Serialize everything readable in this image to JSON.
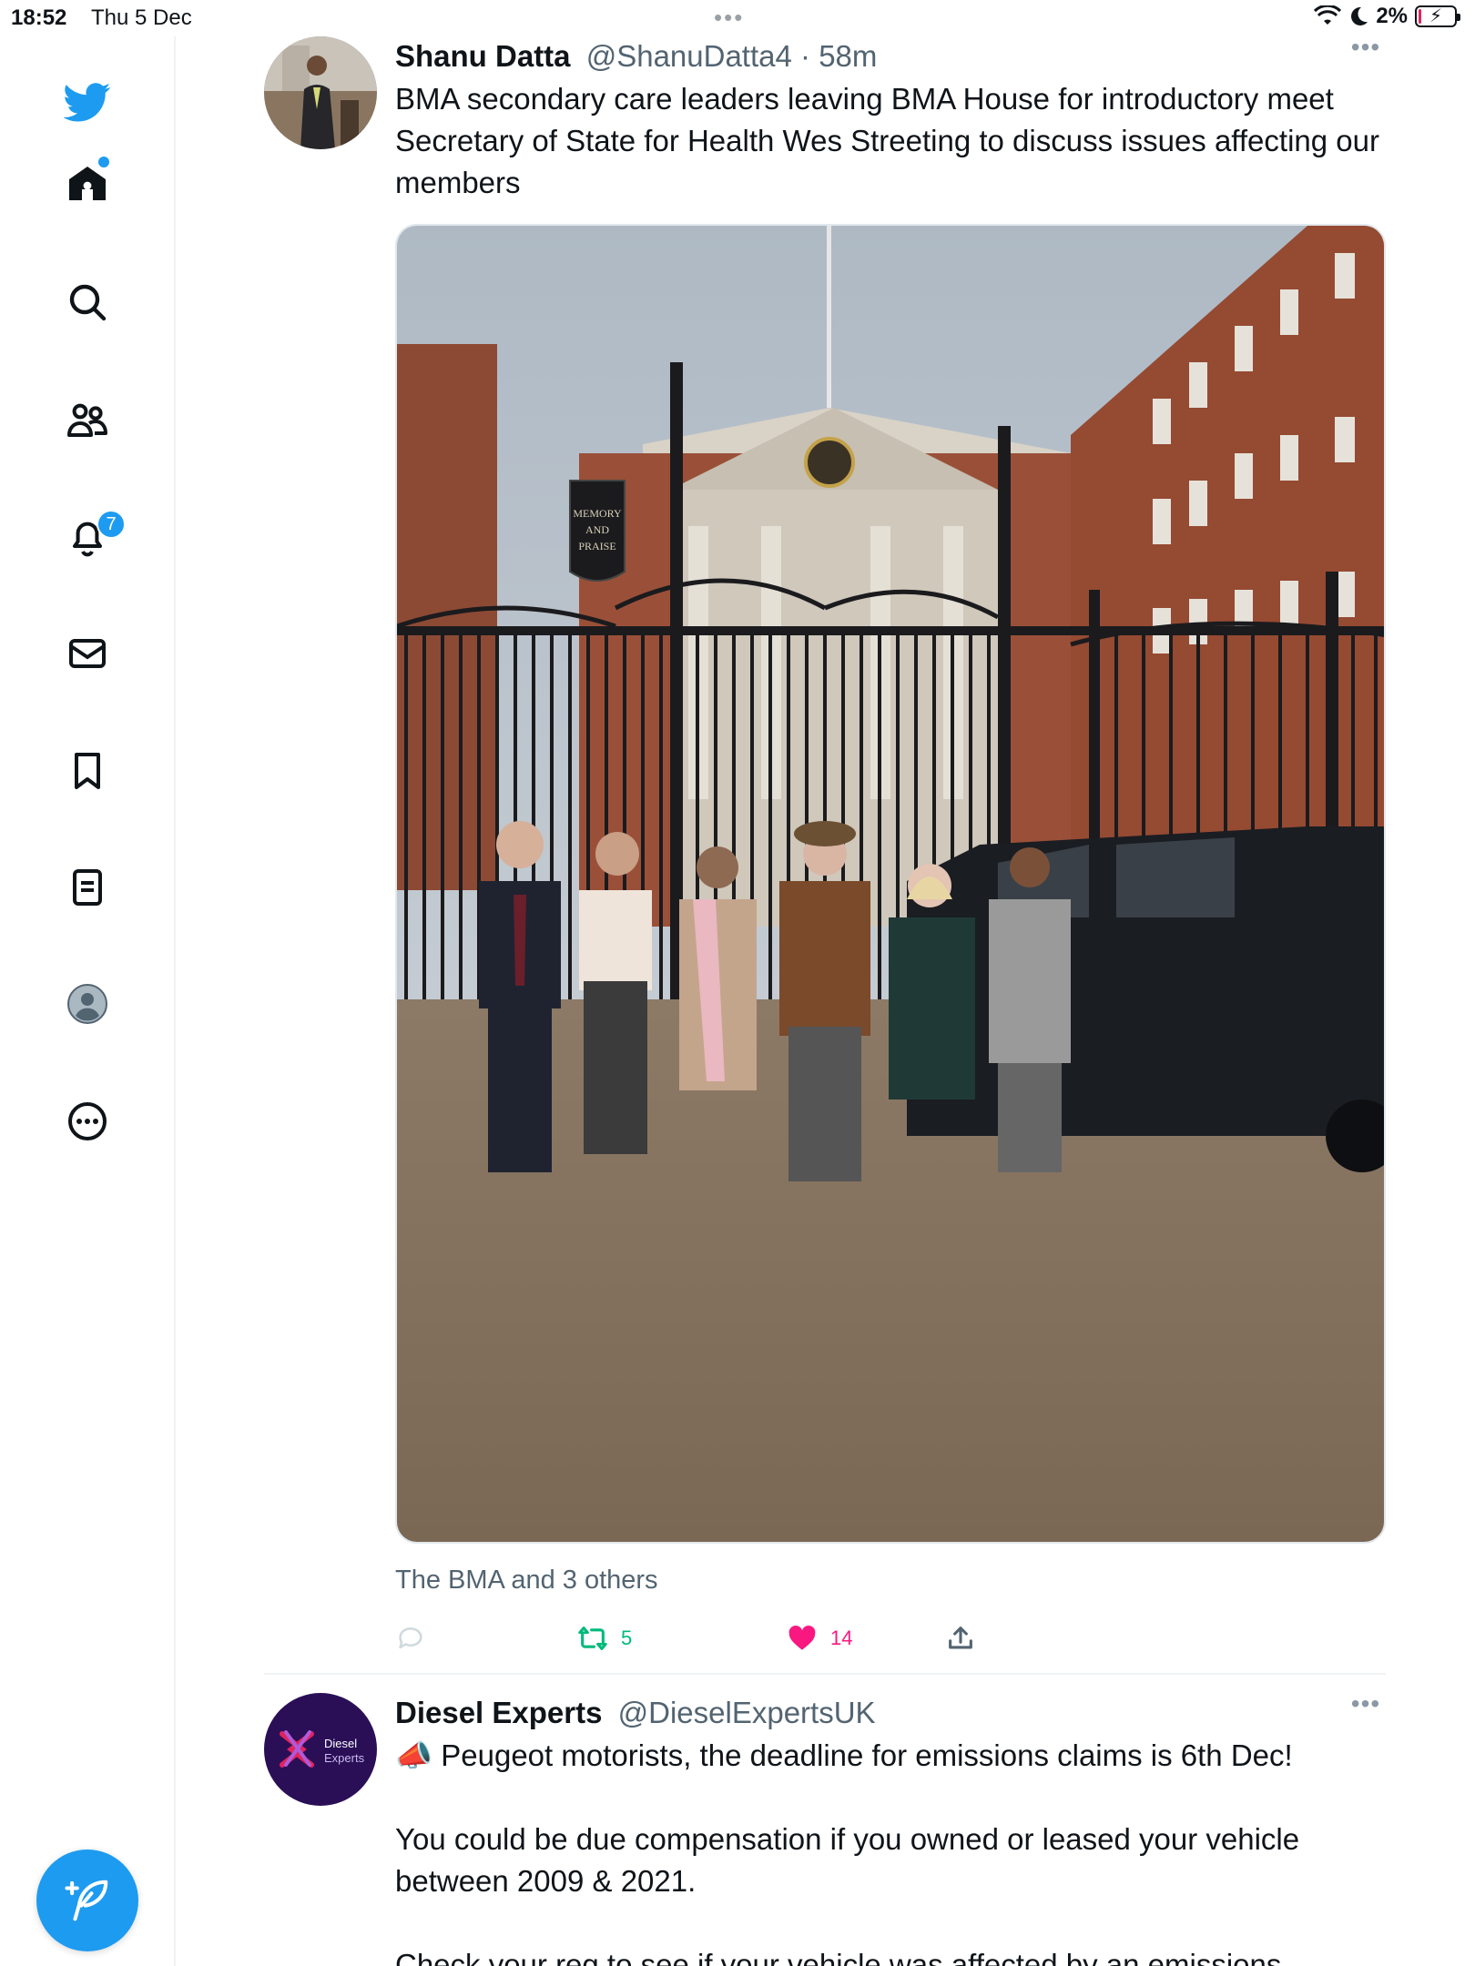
{
  "status_bar": {
    "time": "18:52",
    "date": "Thu 5 Dec",
    "battery_percent": "2%",
    "battery_level": 0.02
  },
  "sidebar": {
    "items": [
      {
        "name": "home",
        "icon": "home-icon",
        "has_dot": true
      },
      {
        "name": "explore",
        "icon": "search-icon"
      },
      {
        "name": "communities",
        "icon": "communities-icon"
      },
      {
        "name": "notifications",
        "icon": "bell-icon",
        "badge": "7"
      },
      {
        "name": "messages",
        "icon": "mail-icon"
      },
      {
        "name": "bookmarks",
        "icon": "bookmark-icon"
      },
      {
        "name": "lists",
        "icon": "list-icon"
      },
      {
        "name": "profile",
        "icon": "profile-avatar-icon"
      },
      {
        "name": "more",
        "icon": "more-circle-icon"
      }
    ],
    "compose_icon": "compose-feather-icon",
    "logo_icon": "twitter-bird-icon"
  },
  "colors": {
    "accent": "#1d9bf0",
    "retweet": "#00ba7c",
    "like": "#f91880",
    "secondary_text": "#536471"
  },
  "tweets": [
    {
      "name": "Shanu Datta",
      "handle": "@ShanuDatta4",
      "separator": "·",
      "time": "58m",
      "text": "BMA secondary care leaders leaving BMA House for introductory meet Secretary of State for Health Wes Streeting to discuss issues affecting our members",
      "sign_text": "MEMORY AND PRAISE",
      "social_context": "The BMA and 3 others",
      "retweets": "5",
      "likes": "14"
    },
    {
      "name": "Diesel Experts",
      "handle": "@DieselExpertsUK",
      "avatar_logo_text_1": "Diesel",
      "avatar_logo_text_2": "Experts",
      "text_line_1": "📣 Peugeot motorists, the deadline for emissions claims is 6th Dec!",
      "text_line_2": "You could be due compensation if you owned or leased your vehicle between 2009 & 2021.",
      "text_line_3": "Check your reg to see if your vehicle was affected by an emissions"
    }
  ]
}
